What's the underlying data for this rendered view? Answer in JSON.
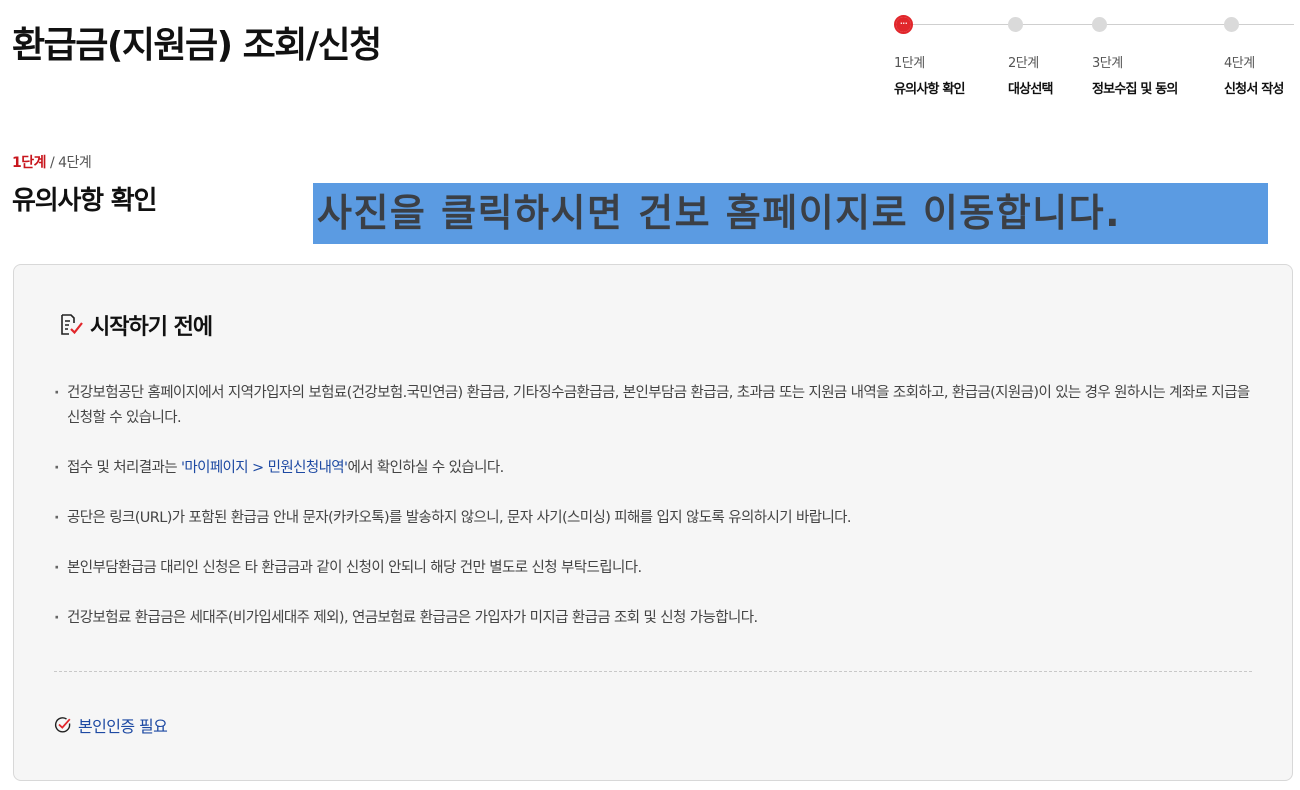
{
  "page": {
    "title": "환급금(지원금) 조회/신청"
  },
  "stepper": {
    "steps": [
      {
        "number": "1단계",
        "label": "유의사항 확인",
        "state": "active"
      },
      {
        "number": "2단계",
        "label": "대상선택",
        "state": "pending"
      },
      {
        "number": "3단계",
        "label": "정보수집 및 동의",
        "state": "pending"
      },
      {
        "number": "4단계",
        "label": "신청서 작성",
        "state": "pending"
      }
    ]
  },
  "stage": {
    "current": "1단계",
    "separator": "/",
    "total": "4단계",
    "title": "유의사항 확인"
  },
  "overlay": {
    "text": "사진을 클릭하시면 건보 홈페이지로 이동합니다."
  },
  "notice": {
    "heading": "시작하기 전에",
    "items": [
      {
        "text": "건강보험공단 홈페이지에서 지역가입자의 보험료(건강보험.국민연금) 환급금, 기타징수금환급금, 본인부담금 환급금, 초과금 또는 지원금 내역을 조회하고, 환급금(지원금)이 있는 경우 원하시는 계좌로 지급을 신청할 수 있습니다."
      },
      {
        "before": "접수 및 처리결과는 ",
        "link": "'마이페이지 > 민원신청내역'",
        "after": "에서 확인하실 수 있습니다."
      },
      {
        "text": "공단은 링크(URL)가 포함된 환급금 안내 문자(카카오톡)를 발송하지 않으니, 문자 사기(스미싱) 피해를 입지 않도록 유의하시기 바랍니다."
      },
      {
        "text": "본인부담환급금 대리인 신청은 타 환급금과 같이 신청이 안되니 해당 건만 별도로 신청 부탁드립니다."
      },
      {
        "text": "건강보험료 환급금은 세대주(비가입세대주 제외), 연금보험료 환급금은 가입자가 미지급 환급금 조회 및 신청 가능합니다."
      }
    ],
    "auth_label": "본인인증 필요"
  },
  "icons": {
    "heading_icon": "checklist-icon",
    "auth_icon": "check-circle-icon"
  },
  "colors": {
    "accent_red": "#e1262b",
    "link_blue": "#1e4aa3",
    "overlay_blue": "#5b9be2",
    "panel_bg": "#f6f6f6"
  }
}
